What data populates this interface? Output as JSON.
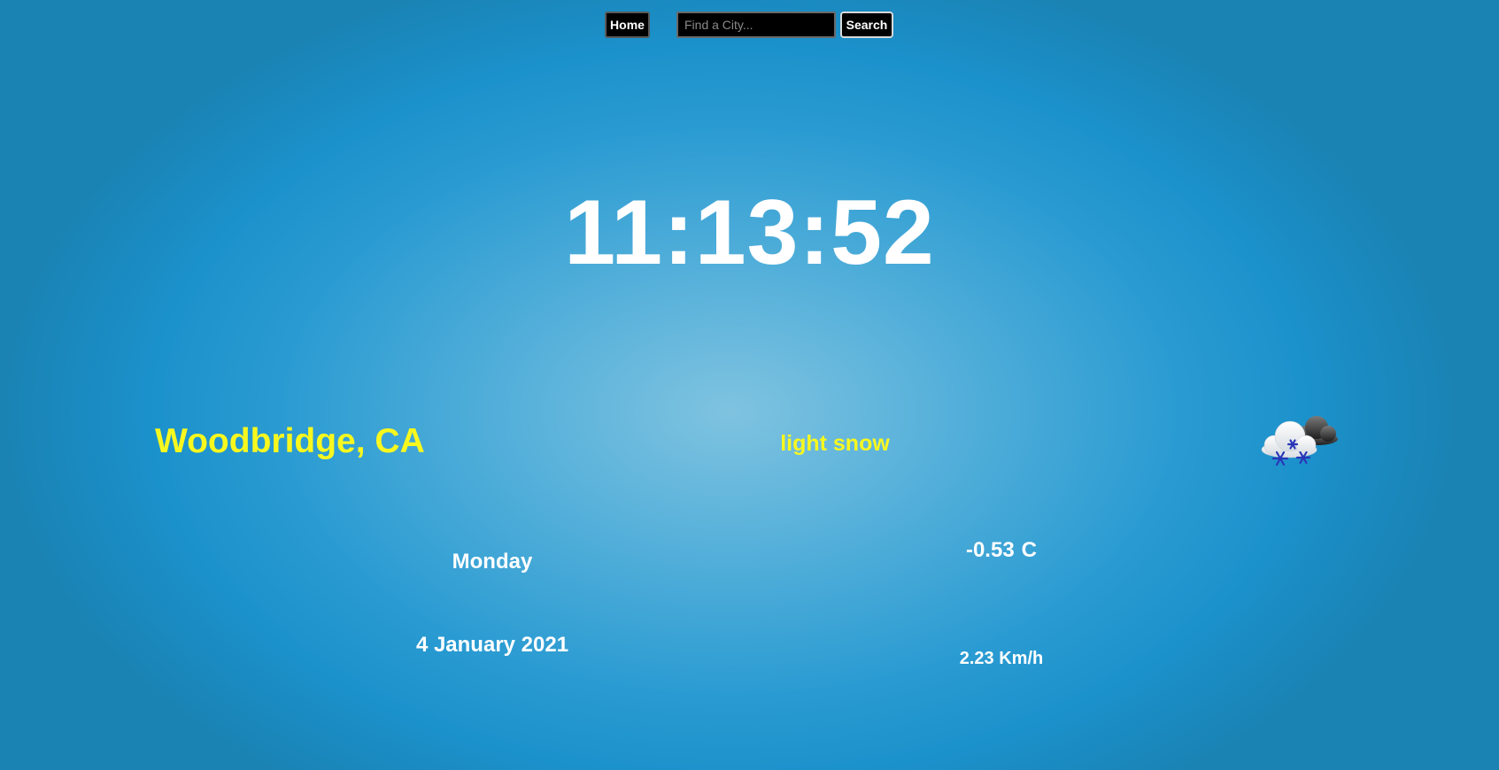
{
  "nav": {
    "home_label": "Home",
    "search_placeholder": "Find a City...",
    "search_value": "",
    "search_button_label": "Search"
  },
  "clock": {
    "time": "11:13:52"
  },
  "weather": {
    "city": "Woodbridge, CA",
    "description": "light snow",
    "icon": "snow-cloud-icon",
    "day": "Monday",
    "date": "4 January 2021",
    "temperature": "-0.53",
    "temperature_unit": "C",
    "wind": "2.23 Km/h"
  },
  "colors": {
    "highlight_text": "#f8f81f",
    "primary_text": "#ffffff",
    "background_center": "#7fc3e0",
    "background_edge": "#1a83b4",
    "button_bg": "#000000"
  }
}
